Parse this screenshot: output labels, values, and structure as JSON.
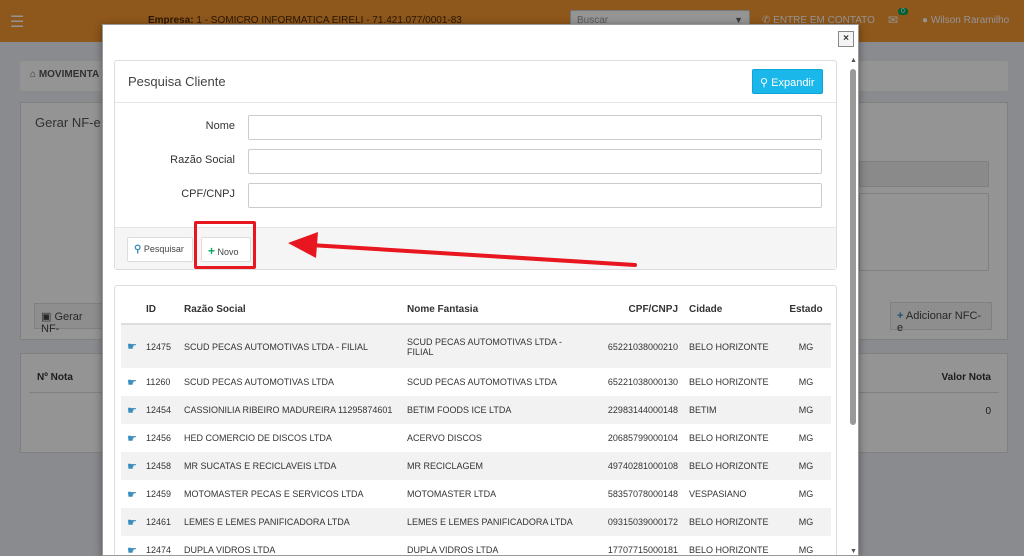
{
  "topbar": {
    "menu_icon": "hamburger-icon",
    "company_label": "Empresa:",
    "company_value": "1 - SOMICRO INFORMATICA EIRELI - 71.421.077/0001-83",
    "search_placeholder": "Buscar",
    "contact_label": "ENTRE EM CONTATO",
    "mail_badge": "0",
    "user_name": "Wilson Raramilho"
  },
  "background": {
    "breadcrumb": "MOVIMENTA",
    "panel_title": "Gerar NF-e a",
    "gerar_button": "Gerar NF-",
    "add_button": "Adicionar NFC-e",
    "col_nota": "Nº Nota",
    "col_valor": "Valor Nota",
    "valor_zero": "0"
  },
  "modal": {
    "close_label": "×",
    "title": "Pesquisa Cliente",
    "expand_label": "Expandir",
    "fields": {
      "nome_label": "Nome",
      "razao_label": "Razão Social",
      "cpf_label": "CPF/CNPJ"
    },
    "pesquisar_label": "Pesquisar",
    "novo_label": "Novo",
    "columns": {
      "id": "ID",
      "razao": "Razão Social",
      "fantasia": "Nome Fantasia",
      "cpf": "CPF/CNPJ",
      "cidade": "Cidade",
      "estado": "Estado"
    },
    "rows": [
      {
        "id": "12475",
        "razao": "SCUD PECAS AUTOMOTIVAS LTDA - FILIAL",
        "fantasia": "SCUD PECAS AUTOMOTIVAS LTDA - FILIAL",
        "cpf": "65221038000210",
        "cidade": "BELO HORIZONTE",
        "estado": "MG"
      },
      {
        "id": "11260",
        "razao": "SCUD PECAS AUTOMOTIVAS LTDA",
        "fantasia": "SCUD PECAS AUTOMOTIVAS LTDA",
        "cpf": "65221038000130",
        "cidade": "BELO HORIZONTE",
        "estado": "MG"
      },
      {
        "id": "12454",
        "razao": "CASSIONILIA RIBEIRO MADUREIRA 11295874601",
        "fantasia": "BETIM FOODS ICE LTDA",
        "cpf": "22983144000148",
        "cidade": "BETIM",
        "estado": "MG"
      },
      {
        "id": "12456",
        "razao": "HED COMERCIO DE DISCOS LTDA",
        "fantasia": "ACERVO DISCOS",
        "cpf": "20685799000104",
        "cidade": "BELO HORIZONTE",
        "estado": "MG"
      },
      {
        "id": "12458",
        "razao": "MR SUCATAS E RECICLAVEIS LTDA",
        "fantasia": "MR RECICLAGEM",
        "cpf": "49740281000108",
        "cidade": "BELO HORIZONTE",
        "estado": "MG"
      },
      {
        "id": "12459",
        "razao": "MOTOMASTER PECAS E SERVICOS LTDA",
        "fantasia": "MOTOMASTER LTDA",
        "cpf": "58357078000148",
        "cidade": "VESPASIANO",
        "estado": "MG"
      },
      {
        "id": "12461",
        "razao": "LEMES E LEMES PANIFICADORA LTDA",
        "fantasia": "LEMES E LEMES PANIFICADORA LTDA",
        "cpf": "09315039000172",
        "cidade": "BELO HORIZONTE",
        "estado": "MG"
      },
      {
        "id": "12474",
        "razao": "DUPLA VIDROS LTDA",
        "fantasia": "DUPLA VIDROS LTDA",
        "cpf": "17707715000181",
        "cidade": "BELO HORIZONTE",
        "estado": "MG"
      }
    ]
  },
  "colors": {
    "topbar": "#f5962f",
    "expand_button": "#1ab7ea",
    "annotation_red": "#e8161e"
  }
}
